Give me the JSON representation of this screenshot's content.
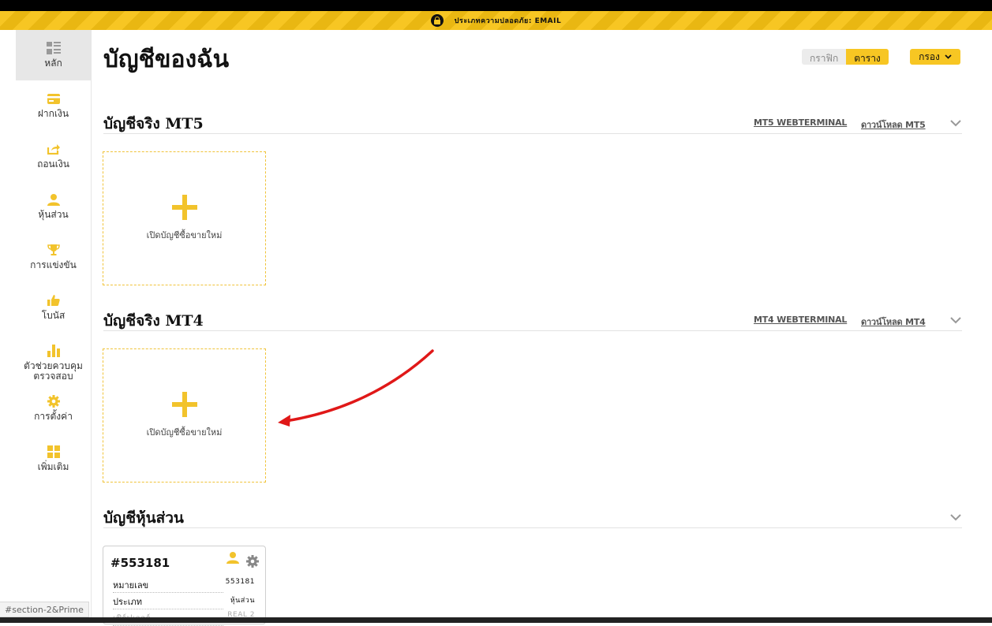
{
  "banner": {
    "text": "ประเภทความปลอดภัย: EMAIL"
  },
  "sidebar": {
    "items": [
      {
        "label": "หลัก",
        "icon": "dashboard-icon"
      },
      {
        "label": "ฝากเงิน",
        "icon": "card-icon"
      },
      {
        "label": "ถอนเงิน",
        "icon": "share-icon"
      },
      {
        "label": "หุ้นส่วน",
        "icon": "user-icon"
      },
      {
        "label": "การแข่งขัน",
        "icon": "trophy-icon"
      },
      {
        "label": "โบนัส",
        "icon": "thumbs-up-icon"
      },
      {
        "label": "ตัวช่วยควบคุม\nตรวจสอบ",
        "icon": "bar-chart-icon"
      },
      {
        "label": "การตั้งค่า",
        "icon": "gear-icon"
      },
      {
        "label": "เพิ่มเติม",
        "icon": "grid-icon"
      }
    ]
  },
  "header": {
    "title": "บัญชีของฉัน",
    "view_toggle": {
      "graph": "กราฟิก",
      "table": "ตาราง"
    },
    "filter_label": "กรอง"
  },
  "sections": {
    "mt5": {
      "title": "บัญชีจริง MT5",
      "webterminal": "MT5 WEBTERMINAL",
      "download": "ดาวน์โหลด MT5",
      "new_label": "เปิดบัญชีซื้อขายใหม่"
    },
    "mt4": {
      "title": "บัญชีจริง MT4",
      "webterminal": "MT4 WEBTERMINAL",
      "download": "ดาวน์โหลด MT4",
      "new_label": "เปิดบัญชีซื้อขายใหม่"
    },
    "partner": {
      "title": "บัญชีหุ้นส่วน"
    }
  },
  "partner_card": {
    "number": "#553181",
    "rows": [
      {
        "key": "หมายเลข",
        "value": "553181"
      },
      {
        "key": "ประเภท",
        "value": "หุ้นส่วน"
      },
      {
        "key": "เซิร์ฟเวอร์",
        "value": "REAL 2"
      }
    ]
  },
  "statusbar": {
    "url": "#section-2&Prime"
  },
  "colors": {
    "accent": "#f7c623",
    "annotation_arrow": "#e01818"
  }
}
